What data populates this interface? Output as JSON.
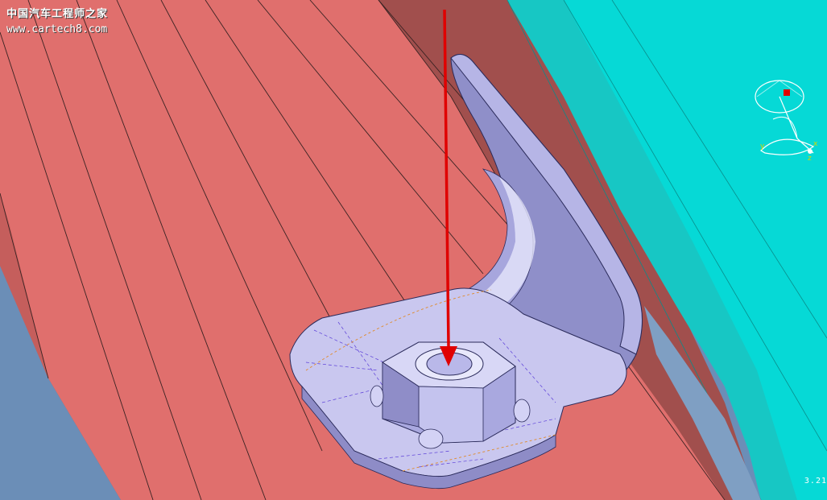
{
  "watermark": {
    "title": "中国汽车工程师之家",
    "url": "www.cartech8.com"
  },
  "triad": {
    "x_label": "x",
    "y_label": "y",
    "z_label": "z"
  },
  "status": {
    "scale_readout": "3.21"
  },
  "icons": {
    "arrow": "red-arrow-icon",
    "triad": "axis-triad-icon"
  },
  "colors": {
    "body_panel": "#e06f6d",
    "panel_shadow": "#a14f4d",
    "cyan_part": "#06d9d6",
    "bracket": "#c9c7ef",
    "arrow": "#e00000",
    "background_blue": "#6b8eb7"
  }
}
